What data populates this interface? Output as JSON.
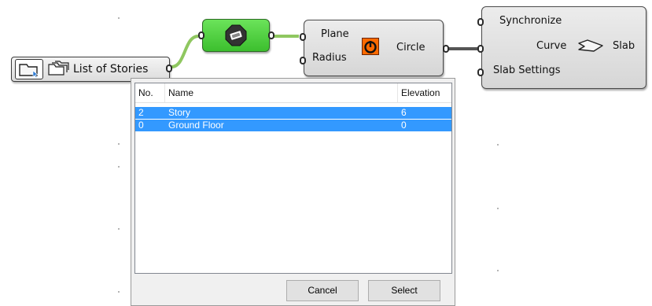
{
  "list_component": {
    "label": "List of Stories"
  },
  "circle_component": {
    "input_plane": "Plane",
    "input_radius": "Radius",
    "output": "Circle"
  },
  "slab_component": {
    "input_sync": "Synchronize",
    "input_curve": "Curve",
    "output": "Slab",
    "input_settings": "Slab Settings"
  },
  "dialog": {
    "columns": {
      "no": "No.",
      "name": "Name",
      "elevation": "Elevation"
    },
    "rows": [
      {
        "no": "2",
        "name": "Story",
        "elevation": "6"
      },
      {
        "no": "0",
        "name": "Ground Floor",
        "elevation": "0"
      }
    ],
    "cancel_label": "Cancel",
    "select_label": "Select"
  },
  "colors": {
    "selection": "#3399ff",
    "wire_green": "#8fc760",
    "param_green": "#52d13f",
    "circle_icon": "#ff6a00",
    "wire_gray": "#555555"
  }
}
